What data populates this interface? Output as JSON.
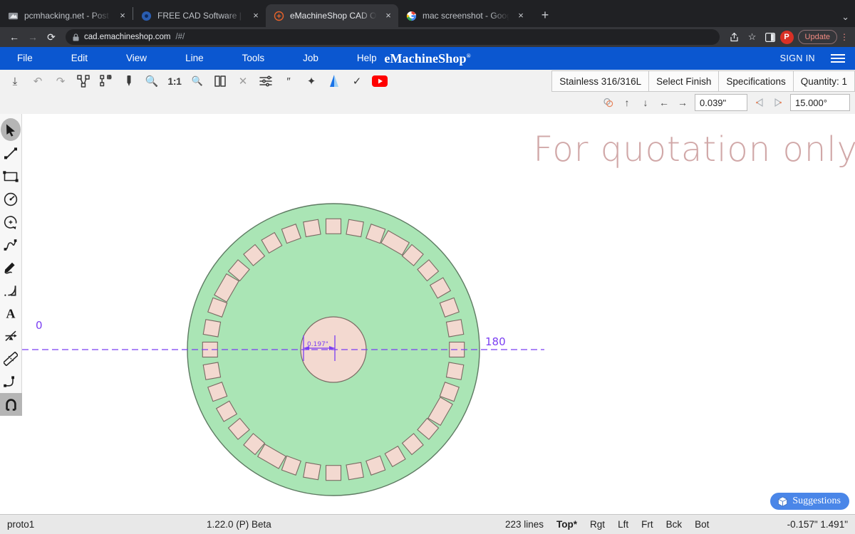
{
  "browser": {
    "tabs": [
      {
        "title": "pcmhacking.net - Post a reply",
        "favicon": "pcm-icon",
        "active": false,
        "close": "×"
      },
      {
        "title": "FREE CAD Software | Design C",
        "favicon": "freecad-icon",
        "active": false,
        "close": "×"
      },
      {
        "title": "eMachineShop CAD Online | No",
        "favicon": "emachineshop-icon",
        "active": true,
        "close": "×"
      },
      {
        "title": "mac screenshot - Google Sear",
        "favicon": "google-icon",
        "active": false,
        "close": "×"
      }
    ],
    "new_tab_label": "+",
    "tab_list_chevron": "⌄",
    "nav": {
      "back": "←",
      "forward": "→",
      "reload": "⟳"
    },
    "url": {
      "lock": "🔒",
      "host": "cad.emachineshop.com",
      "path": "/#/"
    },
    "actions": {
      "share": "⤴",
      "bookmark": "☆",
      "sidepanel": "▣",
      "profile_initial": "P",
      "update_label": "Update",
      "menu": "⋮"
    }
  },
  "menubar": {
    "items": [
      "File",
      "Edit",
      "View",
      "Line",
      "Tools",
      "Job",
      "Help"
    ],
    "brand": "eMachineShop",
    "brand_mark": "®",
    "signin": "SIGN IN",
    "hamburger": "menu-icon"
  },
  "toolbar": {
    "icons": [
      {
        "name": "download-icon",
        "glyph": "⤓",
        "dim": false
      },
      {
        "name": "undo-icon",
        "glyph": "↶",
        "dim": true
      },
      {
        "name": "redo-icon",
        "glyph": "↷",
        "dim": true
      },
      {
        "name": "explode-icon",
        "glyph": "explode",
        "dim": false
      },
      {
        "name": "group-add-icon",
        "glyph": "groupadd",
        "dim": false
      },
      {
        "name": "eyedropper-icon",
        "glyph": "dropper",
        "dim": false
      },
      {
        "name": "zoom-in-icon",
        "glyph": "🔍",
        "dim": false
      },
      {
        "name": "scale-1-1-icon",
        "glyph": "1:1",
        "dim": false
      },
      {
        "name": "zoom-out-icon",
        "glyph": "🔍",
        "dim": false
      },
      {
        "name": "page-view-icon",
        "glyph": "book",
        "dim": false
      },
      {
        "name": "delete-icon",
        "glyph": "✕",
        "dim": true
      },
      {
        "name": "settings-sliders-icon",
        "glyph": "sliders",
        "dim": false
      },
      {
        "name": "inch-units-icon",
        "glyph": "″",
        "dim": false
      },
      {
        "name": "add-feature-icon",
        "glyph": "✦",
        "dim": false
      },
      {
        "name": "3d-view-icon",
        "glyph": "cone",
        "dim": false
      },
      {
        "name": "check-icon",
        "glyph": "✓",
        "dim": false
      },
      {
        "name": "youtube-icon",
        "glyph": "youtube",
        "dim": false
      }
    ],
    "material_buttons": [
      {
        "name": "material-button",
        "label": "Stainless 316/316L"
      },
      {
        "name": "select-finish-button",
        "label": "Select Finish"
      },
      {
        "name": "specifications-button",
        "label": "Specifications"
      },
      {
        "name": "quantity-button",
        "label": "Quantity: 1"
      }
    ],
    "nudge": {
      "copy_icon": "copy-shapes-icon",
      "up": "↑",
      "down": "↓",
      "left": "←",
      "right": "→",
      "distance_value": "0.039\"",
      "rotate_ccw": "◁",
      "rotate_cw": "▷",
      "angle_value": "15.000°"
    }
  },
  "rail": {
    "tools": [
      {
        "name": "select-tool",
        "selected": true,
        "label": "Select"
      },
      {
        "name": "line-tool",
        "selected": false,
        "label": "Line"
      },
      {
        "name": "rectangle-tool",
        "selected": false,
        "label": "Rectangle"
      },
      {
        "name": "circle-tool",
        "selected": false,
        "label": "Circle"
      },
      {
        "name": "arc-tool",
        "selected": false,
        "label": "Arc"
      },
      {
        "name": "spline-tool",
        "selected": false,
        "label": "Spline"
      },
      {
        "name": "freehand-tool",
        "selected": false,
        "label": "Freehand"
      },
      {
        "name": "fillet-tool",
        "selected": false,
        "label": "Fillet"
      },
      {
        "name": "text-tool",
        "selected": false,
        "label": "Text"
      },
      {
        "name": "dimension-tool",
        "selected": false,
        "label": "Dimension"
      },
      {
        "name": "ruler-tool",
        "selected": false,
        "label": "Measure"
      },
      {
        "name": "corner-tool",
        "selected": false,
        "label": "Corner"
      },
      {
        "name": "snap-magnet-tool",
        "selected": true,
        "label": "Snap"
      }
    ]
  },
  "canvas": {
    "watermark": "For quotation only",
    "angle_labels": {
      "start": "0",
      "end": "180"
    },
    "dimension_label": "0.197\"",
    "suggestions_label": "Suggestions",
    "suggestions_icon": "cube-icon",
    "colors": {
      "part_fill": "#aae5b5",
      "part_stroke": "#5e7a62",
      "hole_fill": "#f3d9d0",
      "hole_stroke": "#7a6a63",
      "axis": "#7b3ff2",
      "watermark": "#c99a9a",
      "accent_blue": "#0b57d0"
    },
    "part": {
      "outer_radius_px": 205,
      "hub_radius_px": 46,
      "center": [
        437,
        331
      ],
      "hole_count": 36
    }
  },
  "statusbar": {
    "project": "proto1",
    "version": "1.22.0 (P) Beta",
    "line_count": "223 lines",
    "views": [
      {
        "label": "Top*",
        "active": true
      },
      {
        "label": "Rgt",
        "active": false
      },
      {
        "label": "Lft",
        "active": false
      },
      {
        "label": "Frt",
        "active": false
      },
      {
        "label": "Bck",
        "active": false
      },
      {
        "label": "Bot",
        "active": false
      }
    ],
    "coordinates": "-0.157\" 1.491\""
  }
}
